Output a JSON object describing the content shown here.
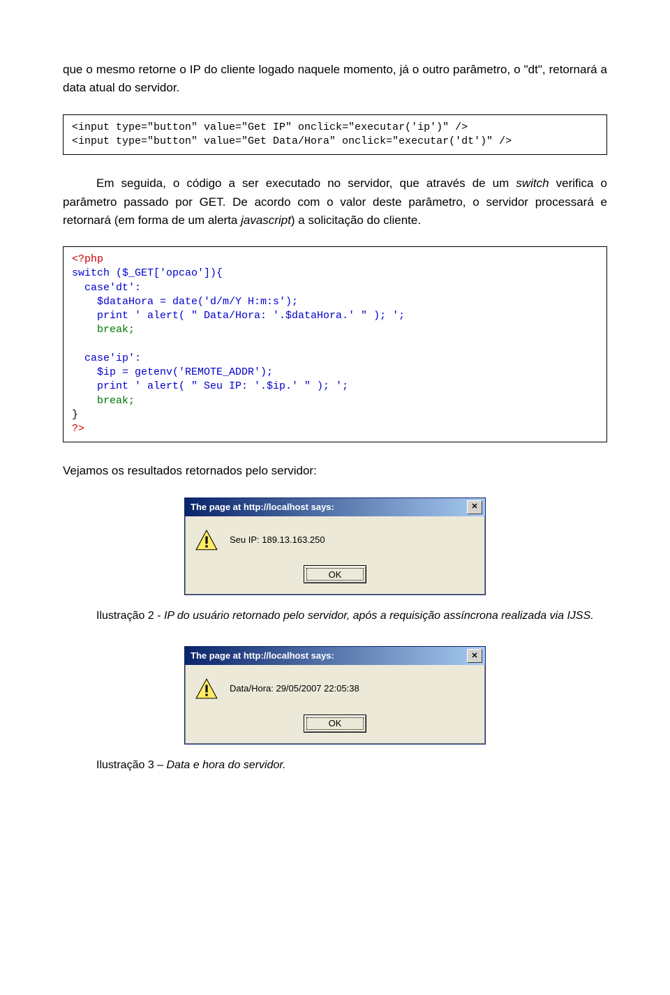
{
  "paragraphs": {
    "p1": "que o mesmo retorne o IP do cliente logado naquele momento, já o outro parâmetro, o \"dt\", retornará a data atual do servidor.",
    "p2_part1": "Em seguida, o código a ser executado no servidor, que através de um ",
    "p2_switch": "switch",
    "p2_part2": " verifica o parâmetro passado por GET. De acordo com o valor deste parâmetro, o servidor processará e retornará (em forma de um alerta ",
    "p2_js": "javascript",
    "p2_part3": ") a solicitação do cliente.",
    "p3": "Vejamos os resultados retornados pelo servidor:"
  },
  "code1": {
    "line1": "<input type=\"button\" value=\"Get IP\" onclick=\"executar('ip')\" />",
    "line2": "<input type=\"button\" value=\"Get Data/Hora\" onclick=\"executar('dt')\" />"
  },
  "code2": {
    "l1": "<?php",
    "l2": "switch ($_GET['opcao']){",
    "l3": "  case'dt':",
    "l4": "    $dataHora = date('d/m/Y H:m:s');",
    "l5": "    print ' alert( \" Data/Hora: '.$dataHora.' \" ); ';",
    "l6": "    break;",
    "l7": "",
    "l8": "  case'ip':",
    "l9": "    $ip = getenv('REMOTE_ADDR');",
    "l10": "    print ' alert( \" Seu IP: '.$ip.' \" ); ';",
    "l11": "    break;",
    "l12": "}",
    "l13": "?>"
  },
  "dialog1": {
    "title": "The page at http://localhost says:",
    "message": "Seu IP: 189.13.163.250",
    "ok": "OK",
    "close_symbol": "✕"
  },
  "dialog2": {
    "title": "The page at http://localhost says:",
    "message": "Data/Hora: 29/05/2007 22:05:38",
    "ok": "OK",
    "close_symbol": "✕"
  },
  "captions": {
    "c1_prefix": "Ilustração 2 - ",
    "c1_body": "IP do usuário retornado pelo servidor, após a requisição assíncrona realizada via IJSS.",
    "c2_prefix": "Ilustração 3 – ",
    "c2_body": "Data e hora do servidor."
  }
}
